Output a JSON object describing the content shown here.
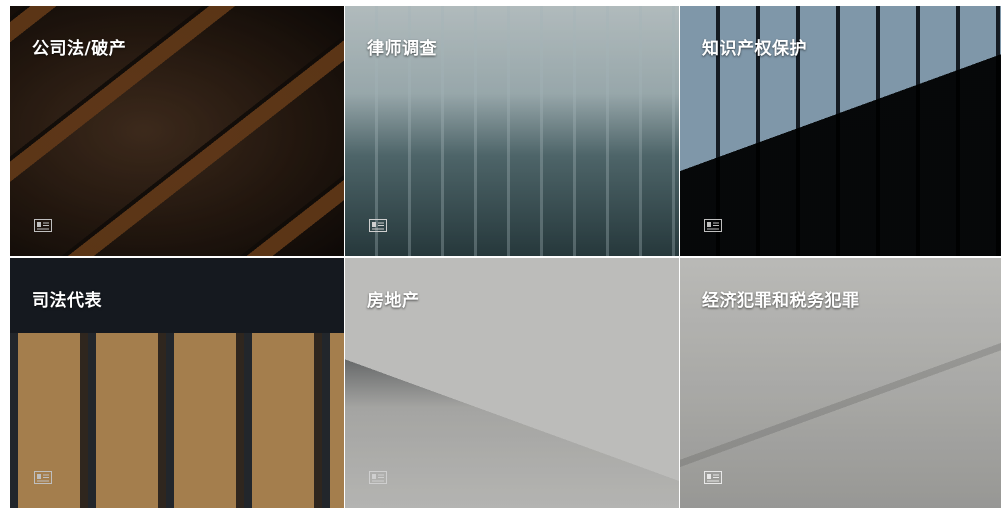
{
  "tiles": [
    {
      "title": "公司法/破产",
      "icon": "card-icon"
    },
    {
      "title": "律师调查",
      "icon": "card-icon"
    },
    {
      "title": "知识产权保护",
      "icon": "card-icon"
    },
    {
      "title": "司法代表",
      "icon": "card-icon"
    },
    {
      "title": "房地产",
      "icon": "card-icon"
    },
    {
      "title": "经济犯罪和税务犯罪",
      "icon": "card-icon"
    }
  ]
}
